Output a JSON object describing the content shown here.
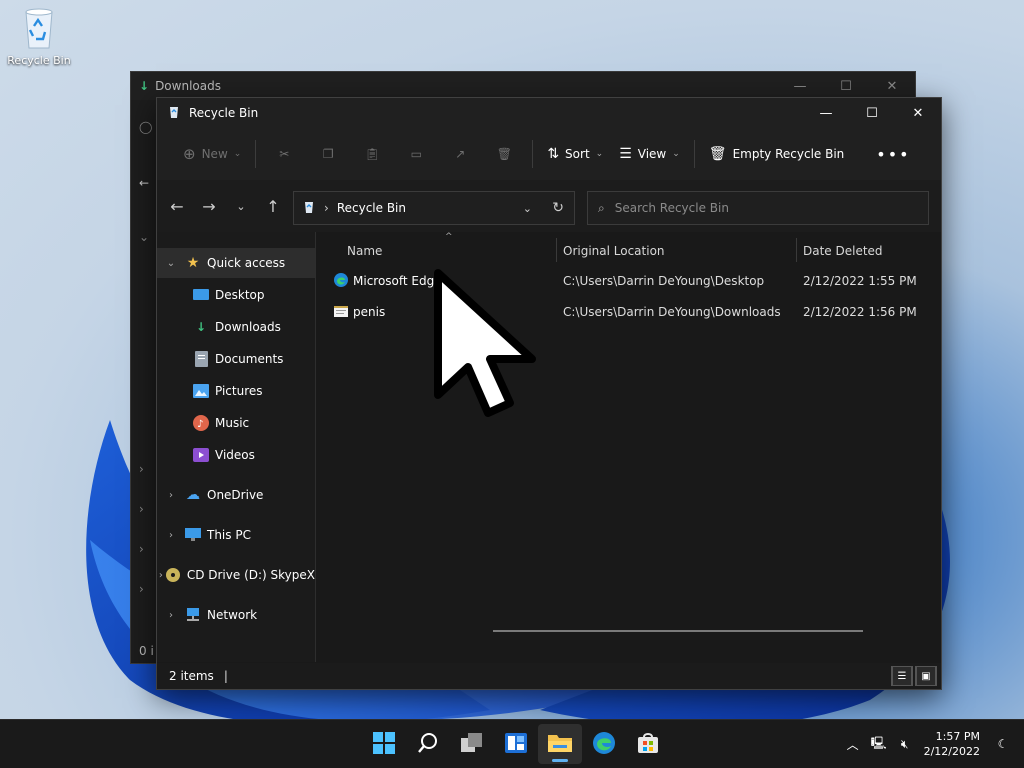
{
  "desktop": {
    "recycle_bin_label": "Recycle Bin"
  },
  "back_window": {
    "title": "Downloads",
    "status_fragment": "0 i"
  },
  "window": {
    "title": "Recycle Bin",
    "toolbar": {
      "new_label": "New",
      "sort_label": "Sort",
      "view_label": "View",
      "empty_label": "Empty Recycle Bin"
    },
    "address": {
      "path": "Recycle Bin"
    },
    "search": {
      "placeholder": "Search Recycle Bin"
    },
    "sidebar": {
      "quick_access": "Quick access",
      "items": [
        {
          "label": "Desktop",
          "icon": "desktop-icon",
          "pinned": true
        },
        {
          "label": "Downloads",
          "icon": "downloads-icon",
          "pinned": true
        },
        {
          "label": "Documents",
          "icon": "documents-icon",
          "pinned": true
        },
        {
          "label": "Pictures",
          "icon": "pictures-icon",
          "pinned": true
        },
        {
          "label": "Music",
          "icon": "music-icon",
          "pinned": false
        },
        {
          "label": "Videos",
          "icon": "videos-icon",
          "pinned": false
        }
      ],
      "roots": [
        {
          "label": "OneDrive",
          "icon": "onedrive-icon"
        },
        {
          "label": "This PC",
          "icon": "this-pc-icon"
        },
        {
          "label": "CD Drive (D:) SkypeX",
          "icon": "cd-drive-icon"
        },
        {
          "label": "Network",
          "icon": "network-icon"
        }
      ]
    },
    "columns": {
      "name": "Name",
      "original_location": "Original Location",
      "date_deleted": "Date Deleted"
    },
    "files": [
      {
        "name": "Microsoft Edge",
        "icon": "edge-shortcut-icon",
        "location": "C:\\Users\\Darrin DeYoung\\Desktop",
        "date": "2/12/2022 1:55 PM"
      },
      {
        "name": "penis",
        "icon": "text-file-icon",
        "location": "C:\\Users\\Darrin DeYoung\\Downloads",
        "date": "2/12/2022 1:56 PM"
      }
    ],
    "status": {
      "item_count": "2 items"
    }
  },
  "taskbar": {
    "time": "1:57 PM",
    "date": "2/12/2022"
  },
  "colors": {
    "accent": "#5fb2f2",
    "folder": "#f2c14e"
  }
}
